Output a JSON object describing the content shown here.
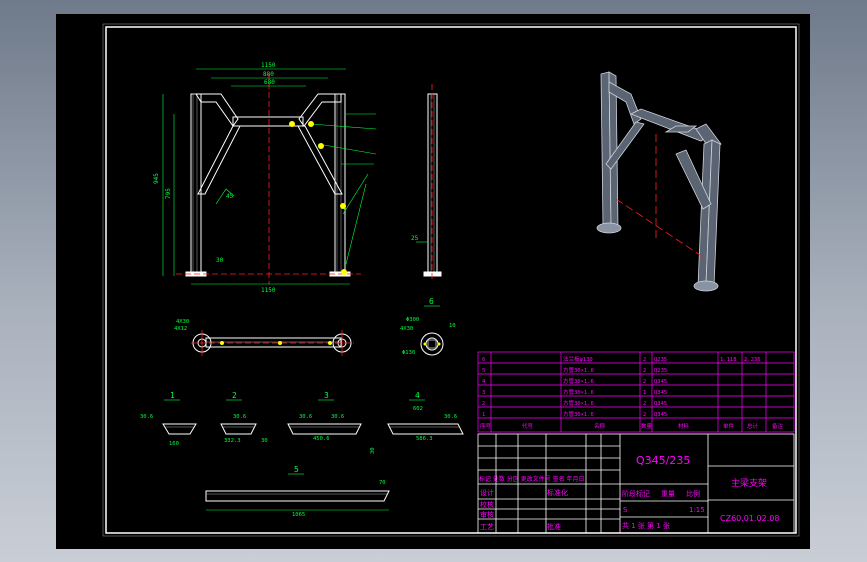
{
  "dims": {
    "front_top": "1150",
    "front_mid": "880",
    "front_inner": "680",
    "front_height": "945",
    "front_height2": "795",
    "front_base": "1150",
    "front_angle": "45",
    "front_foot": "30",
    "side_dim": "25",
    "top_left_label": "4X30",
    "top_left_label2": "4X12",
    "sec6_a": "Φ300",
    "sec6_b": "4X30",
    "sec6_c": "10",
    "sec6_d": "Φ130"
  },
  "section_labels": [
    "1",
    "2",
    "3",
    "4",
    "5",
    "6"
  ],
  "parts": {
    "p1": {
      "l1": "30.6",
      "l2": "160"
    },
    "p2": {
      "l1": "30.6",
      "l2": "332.3",
      "l3": "30"
    },
    "p3": {
      "l1": "30.6",
      "l2": "30.6",
      "l3": "450.6"
    },
    "p4": {
      "l1": "602",
      "l2": "30.6",
      "l3": "586.3"
    },
    "p5": {
      "l1": "1065",
      "l2": "70"
    },
    "side_tick": "30"
  },
  "bom": {
    "rows": [
      {
        "no": "6",
        "code": "",
        "name": "法兰板φ130",
        "qty": "2",
        "mat": "Q235",
        "w1": "1.118",
        "w2": "2.236",
        "note": ""
      },
      {
        "no": "5",
        "code": "",
        "name": "方管30×1.6",
        "qty": "2",
        "mat": "Q235",
        "w1": "",
        "w2": "",
        "note": ""
      },
      {
        "no": "4",
        "code": "",
        "name": "方管30×1.6",
        "qty": "2",
        "mat": "Q345",
        "w1": "",
        "w2": "",
        "note": ""
      },
      {
        "no": "3",
        "code": "",
        "name": "方管30×1.6",
        "qty": "1",
        "mat": "Q345",
        "w1": "",
        "w2": "",
        "note": ""
      },
      {
        "no": "2",
        "code": "",
        "name": "方管30×1.6",
        "qty": "2",
        "mat": "Q345",
        "w1": "",
        "w2": "",
        "note": ""
      },
      {
        "no": "1",
        "code": "",
        "name": "方管30×1.6",
        "qty": "2",
        "mat": "Q345",
        "w1": "",
        "w2": "",
        "note": ""
      }
    ],
    "header": {
      "no": "序号",
      "code": "代号",
      "name": "名称",
      "qty": "数量",
      "mat": "材料",
      "w1": "单件",
      "w2": "总计",
      "note": "备注"
    }
  },
  "title_block": {
    "material": "Q345/235",
    "title": "主梁支架",
    "drawing_no": "CZ60.01.02.08",
    "scale": "1:15",
    "stage": "S",
    "sheets": "共 1 张 第 1 张",
    "rev_header": "标记 处数 分区 更改文件号 签名 年月日",
    "labels": {
      "design": "设计",
      "check": "校核",
      "process": "工艺",
      "standard": "标准化",
      "review": "审核",
      "approve": "批准",
      "stage_label": "阶段标记",
      "weight": "重量",
      "ratio": "比例"
    }
  },
  "colors": {
    "bg": "#000000",
    "white": "#ffffff",
    "green": "#00ff3c",
    "magenta": "#ff00ff",
    "red": "#ff2020",
    "yellow": "#ffff00",
    "frame": "#ffffff"
  }
}
